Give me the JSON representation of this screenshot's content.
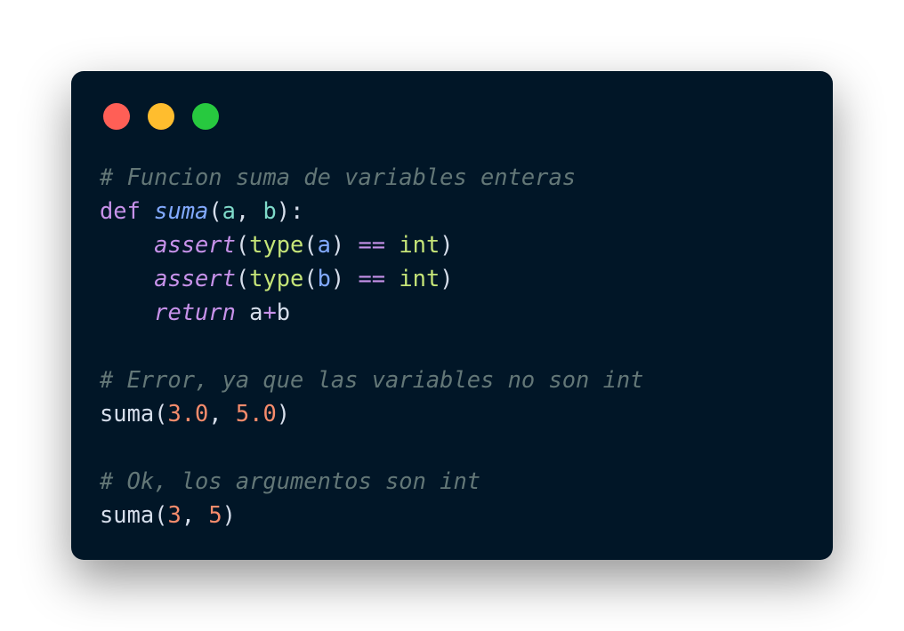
{
  "window": {
    "controls": [
      {
        "name": "close",
        "color": "#ff5f56"
      },
      {
        "name": "minimize",
        "color": "#ffbd2e"
      },
      {
        "name": "maximize",
        "color": "#27c93f"
      }
    ]
  },
  "code": {
    "lines": [
      [
        {
          "t": "# Funcion suma de variables enteras",
          "c": "comment"
        }
      ],
      [
        {
          "t": "def",
          "c": "kw"
        },
        {
          "t": " ",
          "c": "plain"
        },
        {
          "t": "suma",
          "c": "fn-def"
        },
        {
          "t": "(",
          "c": "plain"
        },
        {
          "t": "a",
          "c": "param"
        },
        {
          "t": ", ",
          "c": "plain"
        },
        {
          "t": "b",
          "c": "param"
        },
        {
          "t": "):",
          "c": "plain"
        }
      ],
      [
        {
          "t": "    ",
          "c": "plain"
        },
        {
          "t": "assert",
          "c": "kw-it"
        },
        {
          "t": "(",
          "c": "plain"
        },
        {
          "t": "type",
          "c": "builtin"
        },
        {
          "t": "(",
          "c": "plain"
        },
        {
          "t": "a",
          "c": "var"
        },
        {
          "t": ") ",
          "c": "plain"
        },
        {
          "t": "==",
          "c": "op"
        },
        {
          "t": " ",
          "c": "plain"
        },
        {
          "t": "int",
          "c": "builtin"
        },
        {
          "t": ")",
          "c": "plain"
        }
      ],
      [
        {
          "t": "    ",
          "c": "plain"
        },
        {
          "t": "assert",
          "c": "kw-it"
        },
        {
          "t": "(",
          "c": "plain"
        },
        {
          "t": "type",
          "c": "builtin"
        },
        {
          "t": "(",
          "c": "plain"
        },
        {
          "t": "b",
          "c": "var"
        },
        {
          "t": ") ",
          "c": "plain"
        },
        {
          "t": "==",
          "c": "op"
        },
        {
          "t": " ",
          "c": "plain"
        },
        {
          "t": "int",
          "c": "builtin"
        },
        {
          "t": ")",
          "c": "plain"
        }
      ],
      [
        {
          "t": "    ",
          "c": "plain"
        },
        {
          "t": "return",
          "c": "kw-it"
        },
        {
          "t": " a",
          "c": "plain"
        },
        {
          "t": "+",
          "c": "op"
        },
        {
          "t": "b",
          "c": "plain"
        }
      ],
      [],
      [
        {
          "t": "# Error, ya que las variables no son int",
          "c": "comment"
        }
      ],
      [
        {
          "t": "suma(",
          "c": "plain"
        },
        {
          "t": "3.0",
          "c": "num"
        },
        {
          "t": ", ",
          "c": "plain"
        },
        {
          "t": "5.0",
          "c": "num"
        },
        {
          "t": ")",
          "c": "plain"
        }
      ],
      [],
      [
        {
          "t": "# Ok, los argumentos son int",
          "c": "comment"
        }
      ],
      [
        {
          "t": "suma(",
          "c": "plain"
        },
        {
          "t": "3",
          "c": "num"
        },
        {
          "t": ", ",
          "c": "plain"
        },
        {
          "t": "5",
          "c": "num"
        },
        {
          "t": ")",
          "c": "plain"
        }
      ]
    ]
  }
}
